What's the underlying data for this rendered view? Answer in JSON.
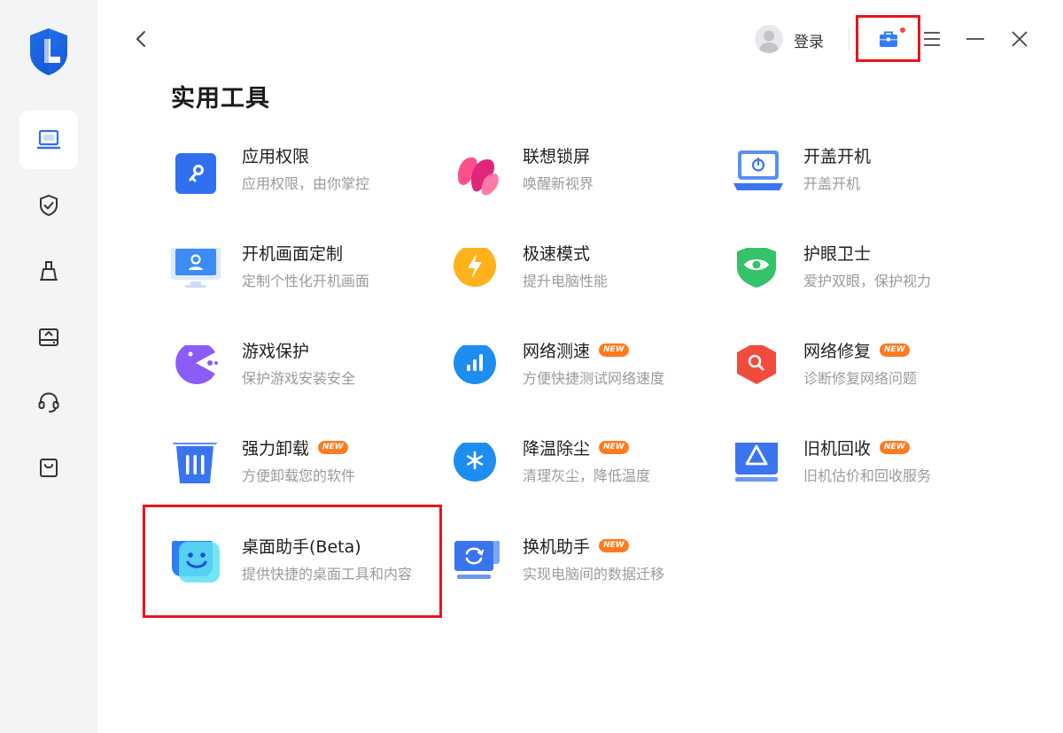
{
  "header": {
    "login_label": "登录"
  },
  "page": {
    "title": "实用工具"
  },
  "tools": [
    {
      "name": "应用权限",
      "desc": "应用权限，由你掌控",
      "badge": ""
    },
    {
      "name": "联想锁屏",
      "desc": "唤醒新视界",
      "badge": ""
    },
    {
      "name": "开盖开机",
      "desc": "开盖开机",
      "badge": ""
    },
    {
      "name": "开机画面定制",
      "desc": "定制个性化开机画面",
      "badge": ""
    },
    {
      "name": "极速模式",
      "desc": "提升电脑性能",
      "badge": ""
    },
    {
      "name": "护眼卫士",
      "desc": "爱护双眼，保护视力",
      "badge": ""
    },
    {
      "name": "游戏保护",
      "desc": "保护游戏安装安全",
      "badge": ""
    },
    {
      "name": "网络测速",
      "desc": "方便快捷测试网络速度",
      "badge": "NEW"
    },
    {
      "name": "网络修复",
      "desc": "诊断修复网络问题",
      "badge": "NEW"
    },
    {
      "name": "强力卸载",
      "desc": "方便卸载您的软件",
      "badge": "NEW"
    },
    {
      "name": "降温除尘",
      "desc": "清理灰尘，降低温度",
      "badge": "NEW"
    },
    {
      "name": "旧机回收",
      "desc": "旧机估价和回收服务",
      "badge": "NEW"
    },
    {
      "name": "桌面助手(Beta)",
      "desc": "提供快捷的桌面工具和内容",
      "badge": ""
    },
    {
      "name": "换机助手",
      "desc": "实现电脑间的数据迁移",
      "badge": "NEW"
    }
  ],
  "colors": {
    "accent": "#2f7cf6",
    "highlight": "#e8141c",
    "badge": "#ff7a1f"
  }
}
